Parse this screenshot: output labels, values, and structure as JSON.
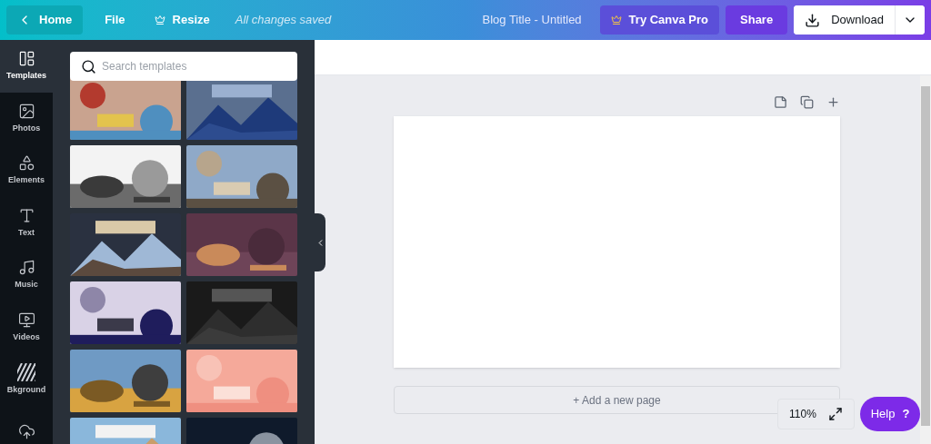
{
  "header": {
    "home": "Home",
    "file": "File",
    "resize": "Resize",
    "save_status": "All changes saved",
    "doc_title": "Blog Title - Untitled",
    "pro": "Try Canva Pro",
    "share": "Share",
    "download": "Download"
  },
  "sidebar": {
    "items": [
      {
        "label": "Templates",
        "selected": true
      },
      {
        "label": "Photos",
        "selected": false
      },
      {
        "label": "Elements",
        "selected": false
      },
      {
        "label": "Text",
        "selected": false
      },
      {
        "label": "Music",
        "selected": false
      },
      {
        "label": "Videos",
        "selected": false
      },
      {
        "label": "Bkground",
        "selected": false
      },
      {
        "selected": false
      }
    ]
  },
  "templates_panel": {
    "search": {
      "placeholder": "Search templates"
    }
  },
  "canvas": {
    "add_page": "+ Add a new page",
    "zoom": "110%",
    "help": "Help",
    "help_mark": "?"
  }
}
